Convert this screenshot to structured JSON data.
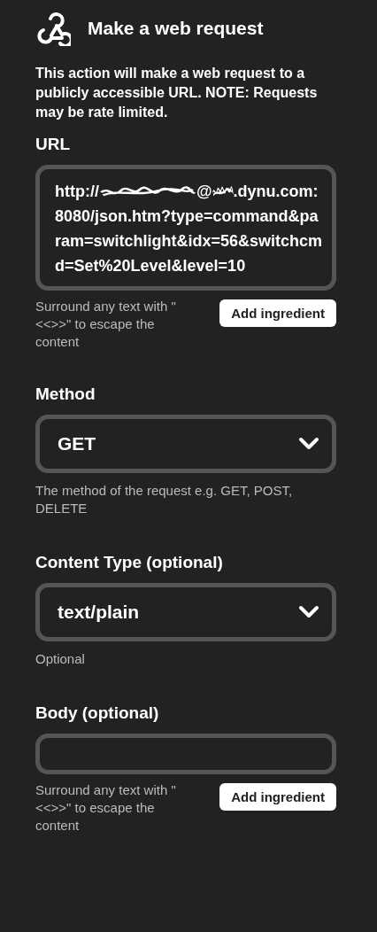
{
  "header": {
    "title": "Make a web request"
  },
  "description": "This action will make a web request to a publicly accessible URL. NOTE: Requests may be rate limited.",
  "fields": [
    {
      "kind": "text",
      "label": "URL",
      "value_parts": [
        {
          "kind": "text",
          "text": "http://"
        },
        {
          "kind": "redaction"
        },
        {
          "kind": "text",
          "text": "@"
        },
        {
          "kind": "redaction"
        },
        {
          "kind": "text",
          "text": ".dynu.com:8080/json.htm?type=command&param=switchlight&idx=56&switchcmd=Set%20Level&level=10"
        }
      ],
      "help": "Surround any text with \"<<>>\" to escape the content",
      "button": "Add ingredient"
    },
    {
      "kind": "select",
      "label": "Method",
      "value": "GET",
      "help": "The method of the request e.g. GET, POST, DELETE"
    },
    {
      "kind": "select",
      "label": "Content Type (optional)",
      "value": "text/plain",
      "help": "Optional"
    },
    {
      "kind": "text",
      "label": "Body (optional)",
      "help": "Surround any text with \"<<>>\" to escape the content",
      "button": "Add ingredient"
    }
  ]
}
